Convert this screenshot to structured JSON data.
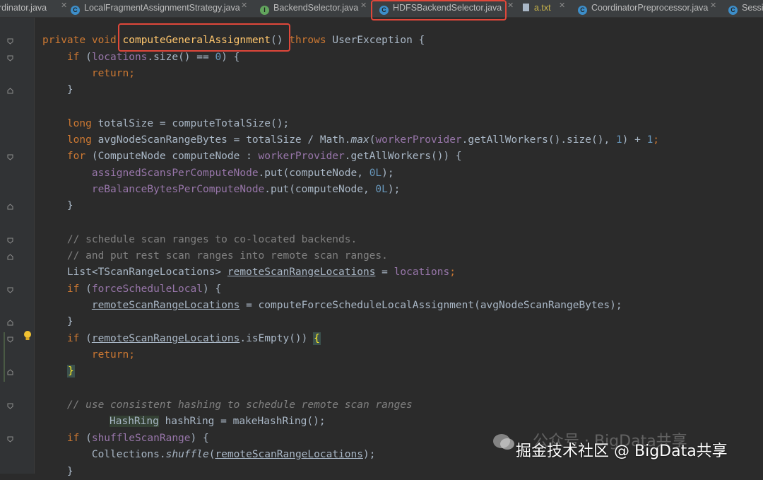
{
  "tabs": [
    {
      "label": "rdinator.java"
    },
    {
      "label": "LocalFragmentAssignmentStrategy.java",
      "icon": "C"
    },
    {
      "label": "BackendSelector.java",
      "icon": "I"
    },
    {
      "label": "HDFSBackendSelector.java",
      "icon": "C"
    },
    {
      "label": "a.txt"
    },
    {
      "label": "CoordinatorPreprocessor.java",
      "icon": "C"
    },
    {
      "label": "Sessi",
      "icon": "C"
    }
  ],
  "colors": {
    "background": "#2b2b2b",
    "keyword": "#cc7832",
    "function": "#ffc66d",
    "number": "#6897bb",
    "field": "#9876aa",
    "comment": "#808080",
    "highlight_box": "#e0473a"
  },
  "code": {
    "l1": {
      "a": "private void ",
      "b": "computeGeneralAssignment",
      "c": "() ",
      "d": "throws",
      " e": "",
      "e": " UserException {"
    },
    "l2": {
      "a": "    if ",
      "b": "(",
      "c": "locations",
      ".d": "",
      "d": ".size() == ",
      "e": "0",
      ".f": "",
      "f": ") {"
    },
    "l3": {
      "a": "        return;"
    },
    "l4": {
      "a": "    }"
    },
    "l5": {
      "a": "    long ",
      "b": "totalSize = computeTotalSize();"
    },
    "l6": {
      "a": "    long ",
      "b": "avgNodeScanRangeBytes = totalSize / Math.",
      "c": "max",
      "d": "(",
      "e": "workerProvider",
      "f": ".getAllWorkers().size(), ",
      "g": "1",
      "h": ") + ",
      "i": "1",
      "j": ";"
    },
    "l7": {
      "a": "    for ",
      "b": "(ComputeNode computeNode : ",
      "c": "workerProvider",
      "d": ".getAllWorkers()) {"
    },
    "l8": {
      "a": "        ",
      "b": "assignedScansPerComputeNode",
      "c": ".put(computeNode, ",
      "d": "0L",
      "e": ");"
    },
    "l9": {
      "a": "        ",
      "b": "reBalanceBytesPerComputeNode",
      "c": ".put(computeNode, ",
      "d": "0L",
      "e": ");"
    },
    "l10": {
      "a": "    }"
    },
    "l11": {
      "a": "    // schedule scan ranges to co-located backends."
    },
    "l12": {
      "a": "    // and put rest scan ranges into remote scan ranges."
    },
    "l13": {
      "a": "    List<TScanRangeLocations> ",
      "b": "remoteScanRangeLocations",
      "c": " = ",
      "d": "locations",
      "e": ";"
    },
    "l14": {
      "a": "    if ",
      "b": "(",
      "c": "forceScheduleLocal",
      "d": ") {"
    },
    "l15": {
      "a": "        ",
      "b": "remoteScanRangeLocations",
      "c": " = computeForceScheduleLocalAssignment(avgNodeScanRangeBytes);"
    },
    "l16": {
      "a": "    }"
    },
    "l17": {
      "a": "    if ",
      "b": "(",
      "c": "remoteScanRangeLocations",
      "d": ".isEmpty()) ",
      "e": "{"
    },
    "l18": {
      "a": "        return;"
    },
    "l19": {
      "a": "}"
    },
    "l20": {
      "a": "    // use consistent hashing to schedule remote scan ranges"
    },
    "l21": {
      "a": "HashRing",
      "b": " hashRing = makeHashRing();"
    },
    "l22": {
      "a": "    if ",
      "b": "(",
      "c": "shuffleScanRange",
      "d": ") {"
    },
    "l23": {
      "a": "        Collections.",
      "b": "shuffle",
      "c": "(",
      "d": "remoteScanRangeLocations",
      "e": ");"
    },
    "l24": {
      "a": "    }"
    }
  },
  "watermark": {
    "ghost": "公众号 · BigData共享",
    "text": "掘金技术社区 @ BigData共享"
  }
}
